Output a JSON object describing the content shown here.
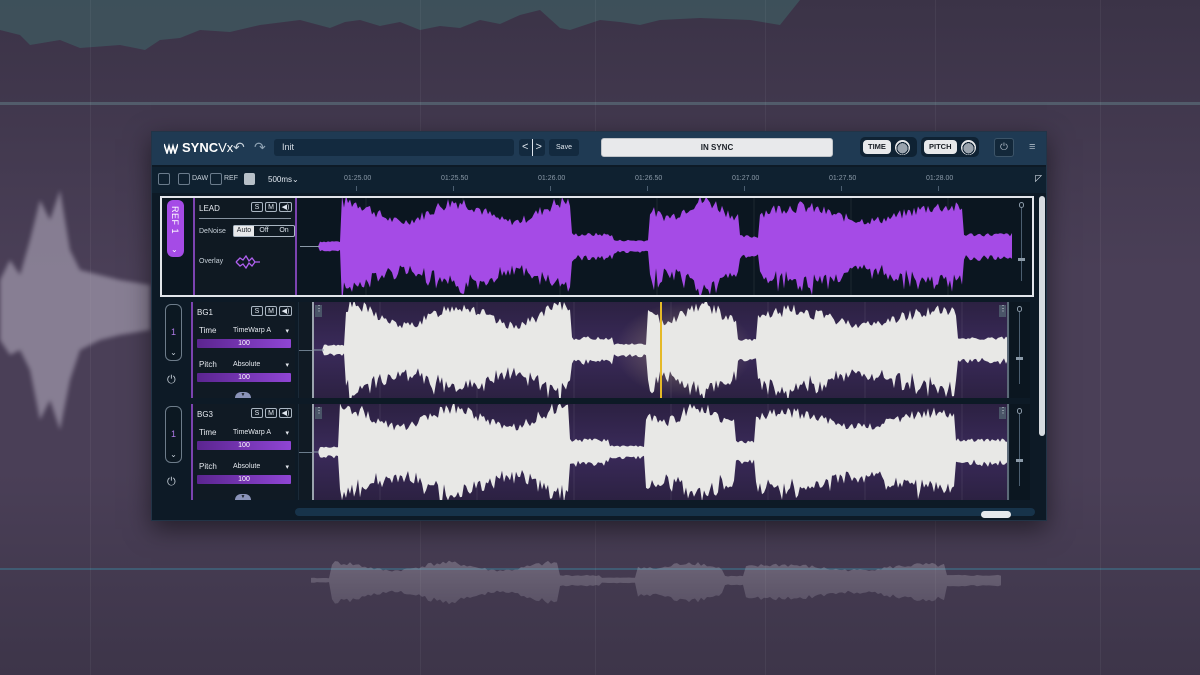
{
  "app": {
    "logo_name": "SYNC",
    "logo_suffix": "Vx",
    "preset_name": "Init",
    "prev_label": "<",
    "next_label": ">",
    "save_label": "Save",
    "status": "IN SYNC",
    "time_toggle": "TIME",
    "pitch_toggle": "PITCH",
    "power_icon": "⏻",
    "menu_icon": "≡",
    "undo_icon": "↶",
    "redo_icon": "↷"
  },
  "ruler": {
    "daw_label": "DAW",
    "ref_label": "REF",
    "resolution": "500ms⌄",
    "ticks": [
      "01:25.00",
      "01:25.50",
      "01:26.00",
      "01:26.50",
      "01:27.00",
      "01:27.50",
      "01:28.00"
    ]
  },
  "tracks": {
    "lead": {
      "tab": "REF 1",
      "chevron": "⌄",
      "name": "LEAD",
      "solo": "S",
      "mute": "M",
      "speaker": "◀)",
      "denoise_label": "DeNoise",
      "denoise_options": [
        "Auto",
        "Off",
        "On"
      ],
      "denoise_selected": "Auto",
      "overlay_label": "Overlay",
      "color": "#a54be6"
    },
    "bg1": {
      "tab": "1",
      "chevron": "⌄",
      "name": "BG1",
      "solo": "S",
      "mute": "M",
      "speaker": "◀)",
      "time_label": "Time",
      "time_mode": "TimeWarp A",
      "time_value": "100",
      "pitch_label": "Pitch",
      "pitch_mode": "Absolute",
      "pitch_value": "100",
      "dropdown": "▾",
      "power": "⏻"
    },
    "bg3": {
      "tab": "1",
      "chevron": "⌄",
      "name": "BG3",
      "solo": "S",
      "mute": "M",
      "speaker": "◀)",
      "time_label": "Time",
      "time_mode": "TimeWarp A",
      "time_value": "100",
      "pitch_label": "Pitch",
      "pitch_mode": "Absolute",
      "pitch_value": "100",
      "dropdown": "▾",
      "power": "⏻"
    }
  },
  "colors": {
    "accent": "#a54be6",
    "playhead": "#e5b928",
    "waveform_bg": "#e8e8e6",
    "panel": "#1f3a53"
  }
}
